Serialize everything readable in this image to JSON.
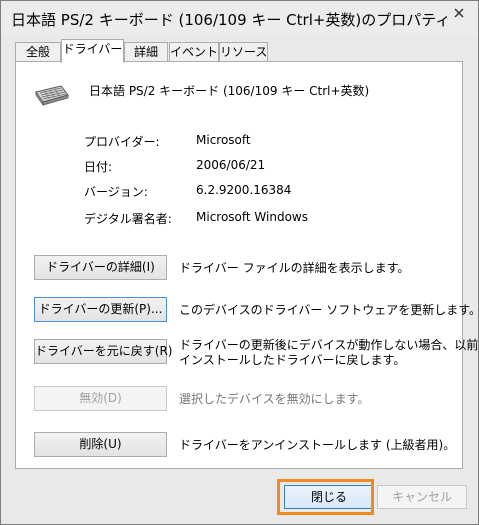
{
  "window": {
    "title": "日本語 PS/2 キーボード (106/109 キー Ctrl+英数)のプロパティ"
  },
  "tabs": [
    {
      "label": "全般"
    },
    {
      "label": "ドライバー"
    },
    {
      "label": "詳細"
    },
    {
      "label": "イベント"
    },
    {
      "label": "リソース"
    }
  ],
  "active_tab": "ドライバー",
  "device": {
    "name": "日本語 PS/2 キーボード (106/109 キー Ctrl+英数)",
    "icon": "keyboard-icon"
  },
  "info": {
    "provider_label": "プロバイダー:",
    "provider_value": "Microsoft",
    "date_label": "日付:",
    "date_value": "2006/06/21",
    "version_label": "バージョン:",
    "version_value": "6.2.9200.16384",
    "signer_label": "デジタル署名者:",
    "signer_value": "Microsoft Windows"
  },
  "actions": {
    "details_button": "ドライバーの詳細(I)",
    "details_desc": "ドライバー ファイルの詳細を表示します。",
    "update_button": "ドライバーの更新(P)...",
    "update_desc": "このデバイスのドライバー ソフトウェアを更新します。",
    "rollback_button": "ドライバーを元に戻す(R)",
    "rollback_desc_line1": "ドライバーの更新後にデバイスが動作しない場合、以前に",
    "rollback_desc_line2": "インストールしたドライバーに戻します。",
    "disable_button": "無効(D)",
    "disable_desc": "選択したデバイスを無効にします。",
    "uninstall_button": "削除(U)",
    "uninstall_desc": "ドライバーをアンインストールします (上級者用)。"
  },
  "footer": {
    "ok_label": "閉じる",
    "cancel_label": "キャンセル"
  },
  "colors": {
    "highlight": "#f08a24",
    "focus_border": "#4a90d0"
  }
}
